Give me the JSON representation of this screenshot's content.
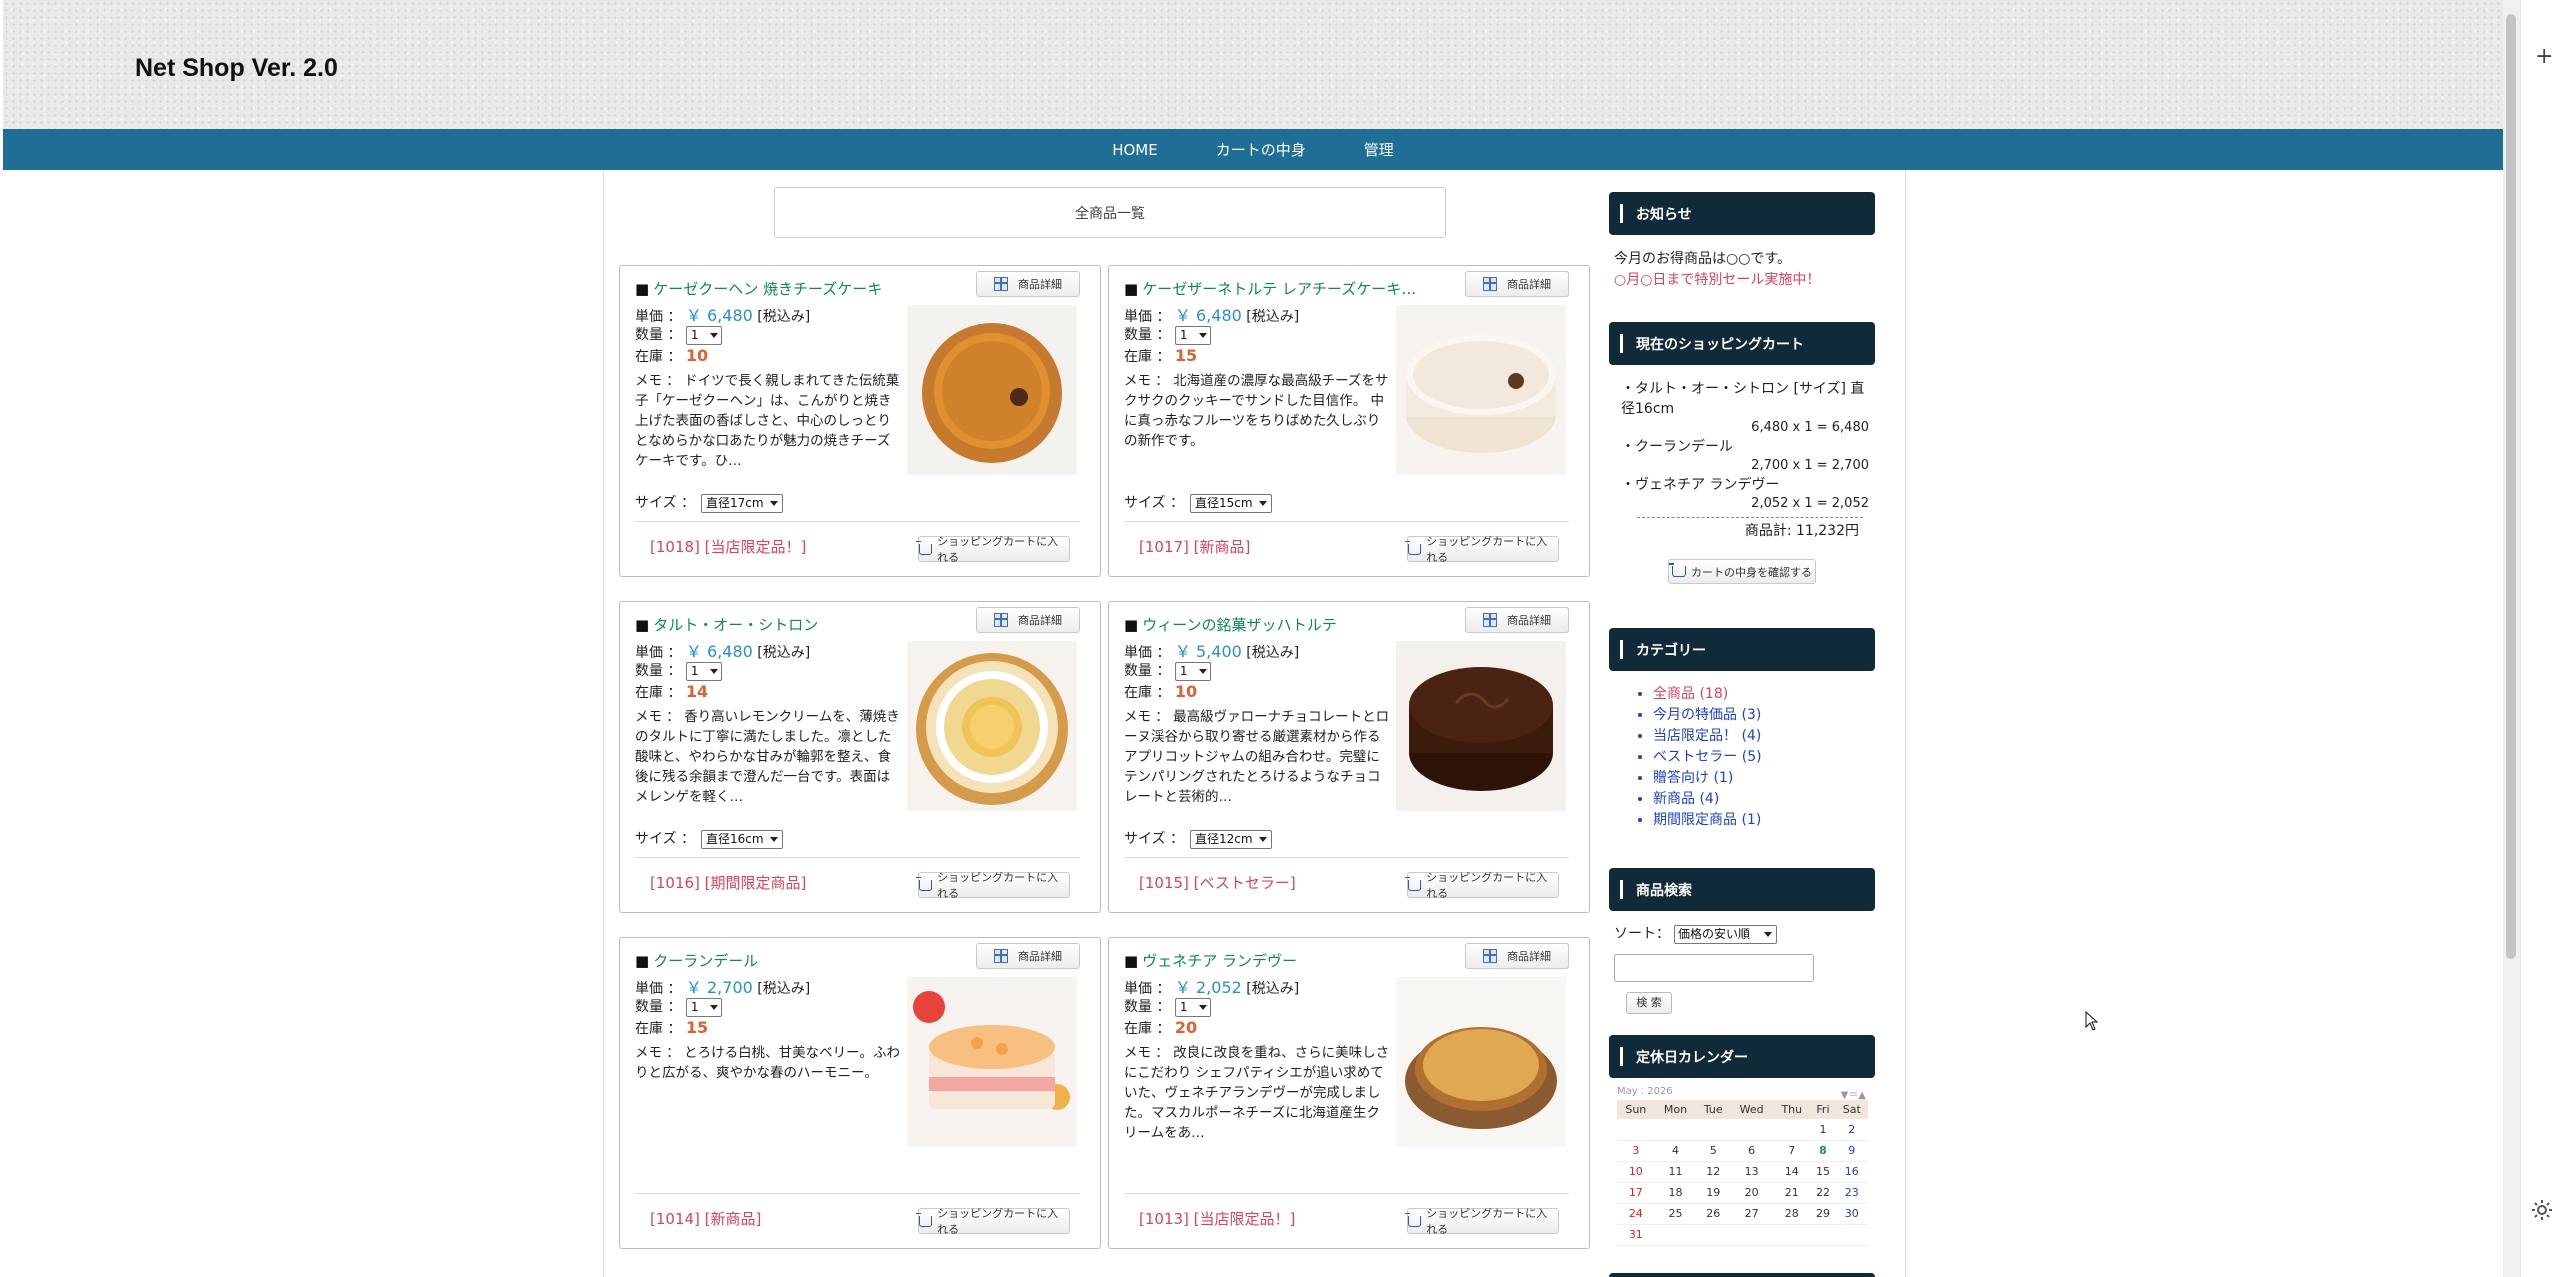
{
  "site": {
    "title": "Net Shop Ver. 2.0"
  },
  "nav": [
    "HOME",
    "カートの中身",
    "管理"
  ],
  "main": {
    "heading": "全商品一覧"
  },
  "labels": {
    "unit_price": "単価 ：",
    "tax": "[税込み]",
    "quantity": "数量 ：",
    "stock": "在庫 ：",
    "memo": "メモ ：",
    "size": "サイズ ：",
    "detail": "商品詳細",
    "add_cart": "ショッピングカートに入れる"
  },
  "products": [
    {
      "name": "ケーゼクーヘン 焼きチーズケーキ",
      "price": "￥ 6,480",
      "qty": "1",
      "stock": "10",
      "memo": "ドイツで長く親しまれてきた伝統菓子「ケーゼクーヘン」は、こんがりと焼き上げた表面の香ばしさと、中心のしっとりとなめらかな口あたりが魅力の焼きチーズケーキです。ひ…",
      "size": "直径17cm",
      "id": "[1018]",
      "tag": "[当店限定品！]",
      "cake": "baked-tart"
    },
    {
      "name": "ケーゼザーネトルテ レアチーズケーキ…",
      "price": "￥ 6,480",
      "qty": "1",
      "stock": "15",
      "memo": "北海道産の濃厚な最高級チーズをサクサクのクッキーでサンドした目信作。 中に真っ赤なフルーツをちりばめた久しぶりの新作です。",
      "size": "直径15cm",
      "id": "[1017]",
      "tag": "[新商品]",
      "cake": "cream-cake"
    },
    {
      "name": "タルト・オー・シトロン",
      "price": "￥ 6,480",
      "qty": "1",
      "stock": "14",
      "memo": "香り高いレモンクリームを、薄焼きのタルトに丁寧に満たしました。凛とした酸味と、やわらかな甘みが輪郭を整え、食後に残る余韻まで澄んだ一台です。表面はメレンゲを軽く…",
      "size": "直径16cm",
      "id": "[1016]",
      "tag": "[期間限定商品]",
      "cake": "lemon-tart"
    },
    {
      "name": "ウィーンの銘菓ザッハトルテ",
      "price": "￥ 5,400",
      "qty": "1",
      "stock": "10",
      "memo": "最高級ヴァローナチョコレートとローヌ渓谷から取り寄せる厳選素材から作るアプリコットジャムの組み合わせ。完璧にテンパリングされたとろけるようなチョコレートと芸術的…",
      "size": "直径12cm",
      "id": "[1015]",
      "tag": "[ベストセラー]",
      "cake": "chocolate"
    },
    {
      "name": "クーランデール",
      "price": "￥ 2,700",
      "qty": "1",
      "stock": "15",
      "memo": "とろける白桃、甘美なベリー。ふわりと広がる、爽やかな春のハーモニー。",
      "size": "",
      "id": "[1014]",
      "tag": "[新商品]",
      "cake": "peach-mousse"
    },
    {
      "name": "ヴェネチア ランデヴー",
      "price": "￥ 2,052",
      "qty": "1",
      "stock": "20",
      "memo": "改良に改良を重ね、さらに美味しさにこだわり シェフパティシエが追い求めていた、ヴェネチアランデヴーが完成しました。マスカルポーネチーズに北海道産生クリームをあ…",
      "size": "",
      "id": "[1013]",
      "tag": "[当店限定品！]",
      "cake": "wood-tart"
    }
  ],
  "sidebar": {
    "news_title": "お知らせ",
    "news_line1": "今月のお得商品は○○です。",
    "news_line2": "○月○日まで特別セール実施中！",
    "cart_title": "現在のショッピングカート",
    "cart_items": [
      {
        "name": "・タルト・オー・シトロン [サイズ] 直径16cm",
        "calc": "6,480 x 1 = 6,480"
      },
      {
        "name": "・クーランデール",
        "calc": "2,700 x 1 = 2,700"
      },
      {
        "name": "・ヴェネチア ランデヴー",
        "calc": "2,052 x 1 = 2,052"
      }
    ],
    "cart_total": "商品計: 11,232円",
    "view_cart": "カートの中身を確認する",
    "category_title": "カテゴリー",
    "categories": [
      {
        "name": "全商品",
        "count": "(18)"
      },
      {
        "name": "今月の特価品",
        "count": "(3)"
      },
      {
        "name": "当店限定品！",
        "count": "(4)"
      },
      {
        "name": "ベストセラー",
        "count": "(5)"
      },
      {
        "name": "贈答向け",
        "count": "(1)"
      },
      {
        "name": "新商品",
        "count": "(4)"
      },
      {
        "name": "期間限定商品",
        "count": "(1)"
      }
    ],
    "search_title": "商品検索",
    "sort_label": "ソート：",
    "sort_value": "価格の安い順",
    "search_button": "検 索",
    "calendar_title": "定休日カレンダー",
    "calendar_month": "May . 2026",
    "calendar_nav": "▼＝▲",
    "weekdays": [
      "Sun",
      "Mon",
      "Tue",
      "Wed",
      "Thu",
      "Fri",
      "Sat"
    ],
    "weeks": [
      [
        "",
        "",
        "",
        "",
        "",
        "1",
        "2"
      ],
      [
        "3",
        "4",
        "5",
        "6",
        "7",
        "8",
        "9"
      ],
      [
        "10",
        "11",
        "12",
        "13",
        "14",
        "15",
        "16"
      ],
      [
        "17",
        "18",
        "19",
        "20",
        "21",
        "22",
        "23"
      ],
      [
        "24",
        "25",
        "26",
        "27",
        "28",
        "29",
        "30"
      ],
      [
        "31",
        "",
        "",
        "",
        "",
        "",
        ""
      ]
    ],
    "calendar_holiday": "8"
  },
  "colors": {
    "nav": "#1f6e95",
    "side_head": "#102a3a",
    "product_name": "#0a8a55",
    "price": "#2a8fd0",
    "stock": "#e06030",
    "tag": "#e0405a"
  }
}
